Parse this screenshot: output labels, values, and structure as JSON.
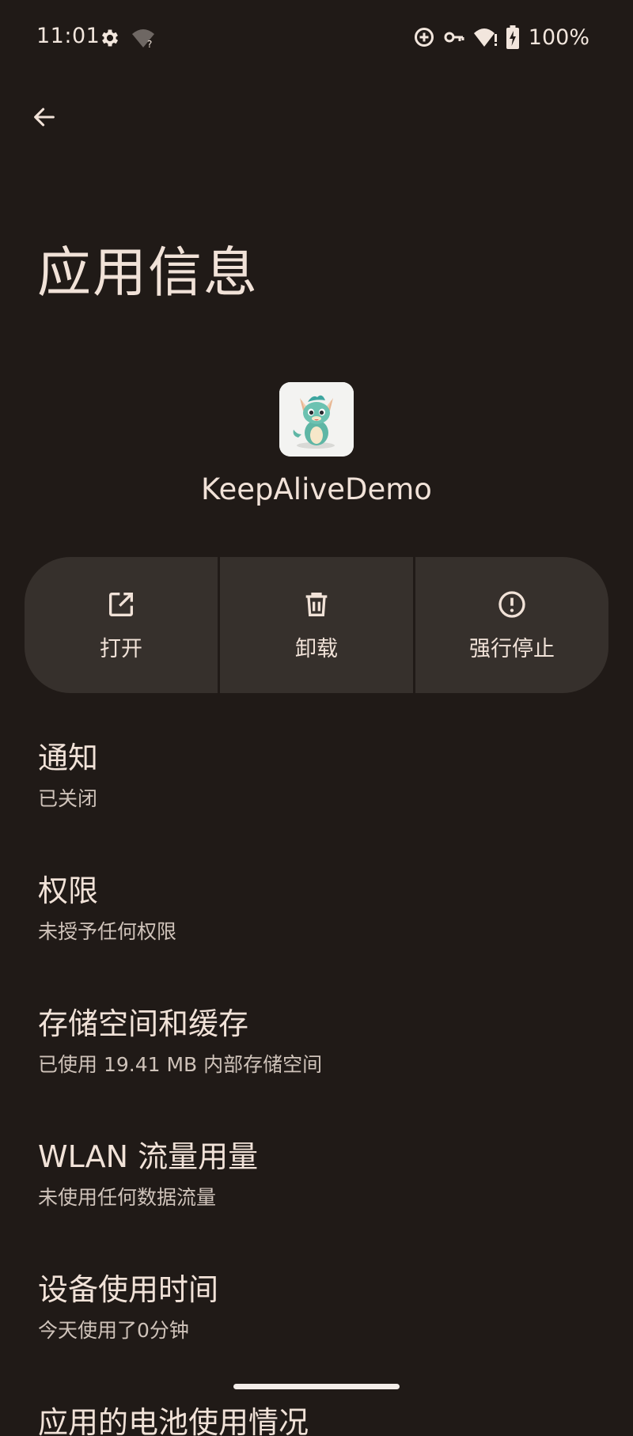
{
  "status_bar": {
    "time": "11:01",
    "left_icons": [
      "gear-icon",
      "wifi-unknown-icon"
    ],
    "right_icons": [
      "data-saver-icon",
      "vpn-key-icon",
      "wifi-alert-icon",
      "battery-charging-icon"
    ],
    "battery_percent": "100%"
  },
  "header": {
    "back_icon": "arrow-back-icon",
    "title": "应用信息"
  },
  "app": {
    "name": "KeepAliveDemo",
    "icon": "dragon-mascot-icon"
  },
  "actions": [
    {
      "label": "打开",
      "icon": "open-external-icon"
    },
    {
      "label": "卸载",
      "icon": "trash-icon"
    },
    {
      "label": "强行停止",
      "icon": "alert-circle-icon"
    }
  ],
  "settings": [
    {
      "title": "通知",
      "subtitle": "已关闭"
    },
    {
      "title": "权限",
      "subtitle": "未授予任何权限"
    },
    {
      "title": "存储空间和缓存",
      "subtitle": "已使用 19.41 MB 内部存储空间"
    },
    {
      "title": "WLAN 流量用量",
      "subtitle": "未使用任何数据流量"
    },
    {
      "title": "设备使用时间",
      "subtitle": "今天使用了0分钟"
    },
    {
      "title": "应用的电池使用情况",
      "subtitle": ""
    }
  ],
  "colors": {
    "background": "#201a17",
    "surface": "#36302c",
    "text_primary": "#f1e2d8",
    "text_secondary": "#cfc3ba"
  }
}
